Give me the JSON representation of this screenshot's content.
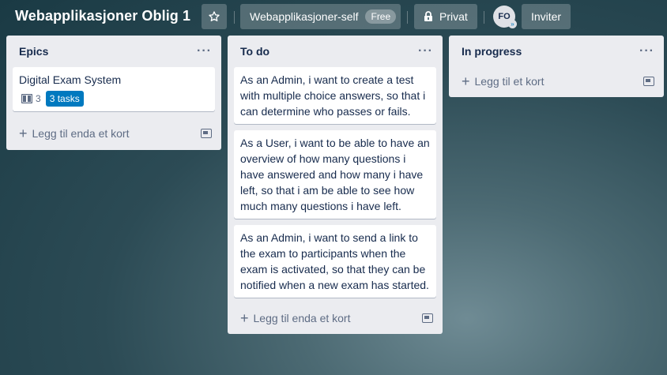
{
  "header": {
    "board_title": "Webapplikasjoner Oblig 1",
    "star_icon": "star-icon",
    "workspace_label": "Webapplikasjoner-self",
    "workspace_badge": "Free",
    "privacy_label": "Privat",
    "avatar_initials": "FO",
    "invite_label": "Inviter"
  },
  "lists": [
    {
      "title": "Epics",
      "menu": "···",
      "cards": [
        {
          "text": "Digital Exam System",
          "checklist_count": "3",
          "label": "3 tasks"
        }
      ],
      "add_label": "Legg til enda et kort"
    },
    {
      "title": "To do",
      "menu": "···",
      "cards": [
        {
          "text": "As an Admin, i want to create a test with multiple choice answers, so that i can determine who passes or fails."
        },
        {
          "text": "As a User, i want to be able to have an overview of how many questions i have answered and how many i have left, so that i am be able to see how much many questions i have left."
        },
        {
          "text": "As an Admin, i want to send a link to the exam to participants when the exam is activated, so that they can be notified when a new exam has started."
        }
      ],
      "add_label": "Legg til enda et kort"
    },
    {
      "title": "In progress",
      "menu": "···",
      "cards": [],
      "add_label": "Legg til et kort"
    }
  ],
  "colors": {
    "label_blue": "#0079bf",
    "list_bg": "#ebecf0"
  }
}
